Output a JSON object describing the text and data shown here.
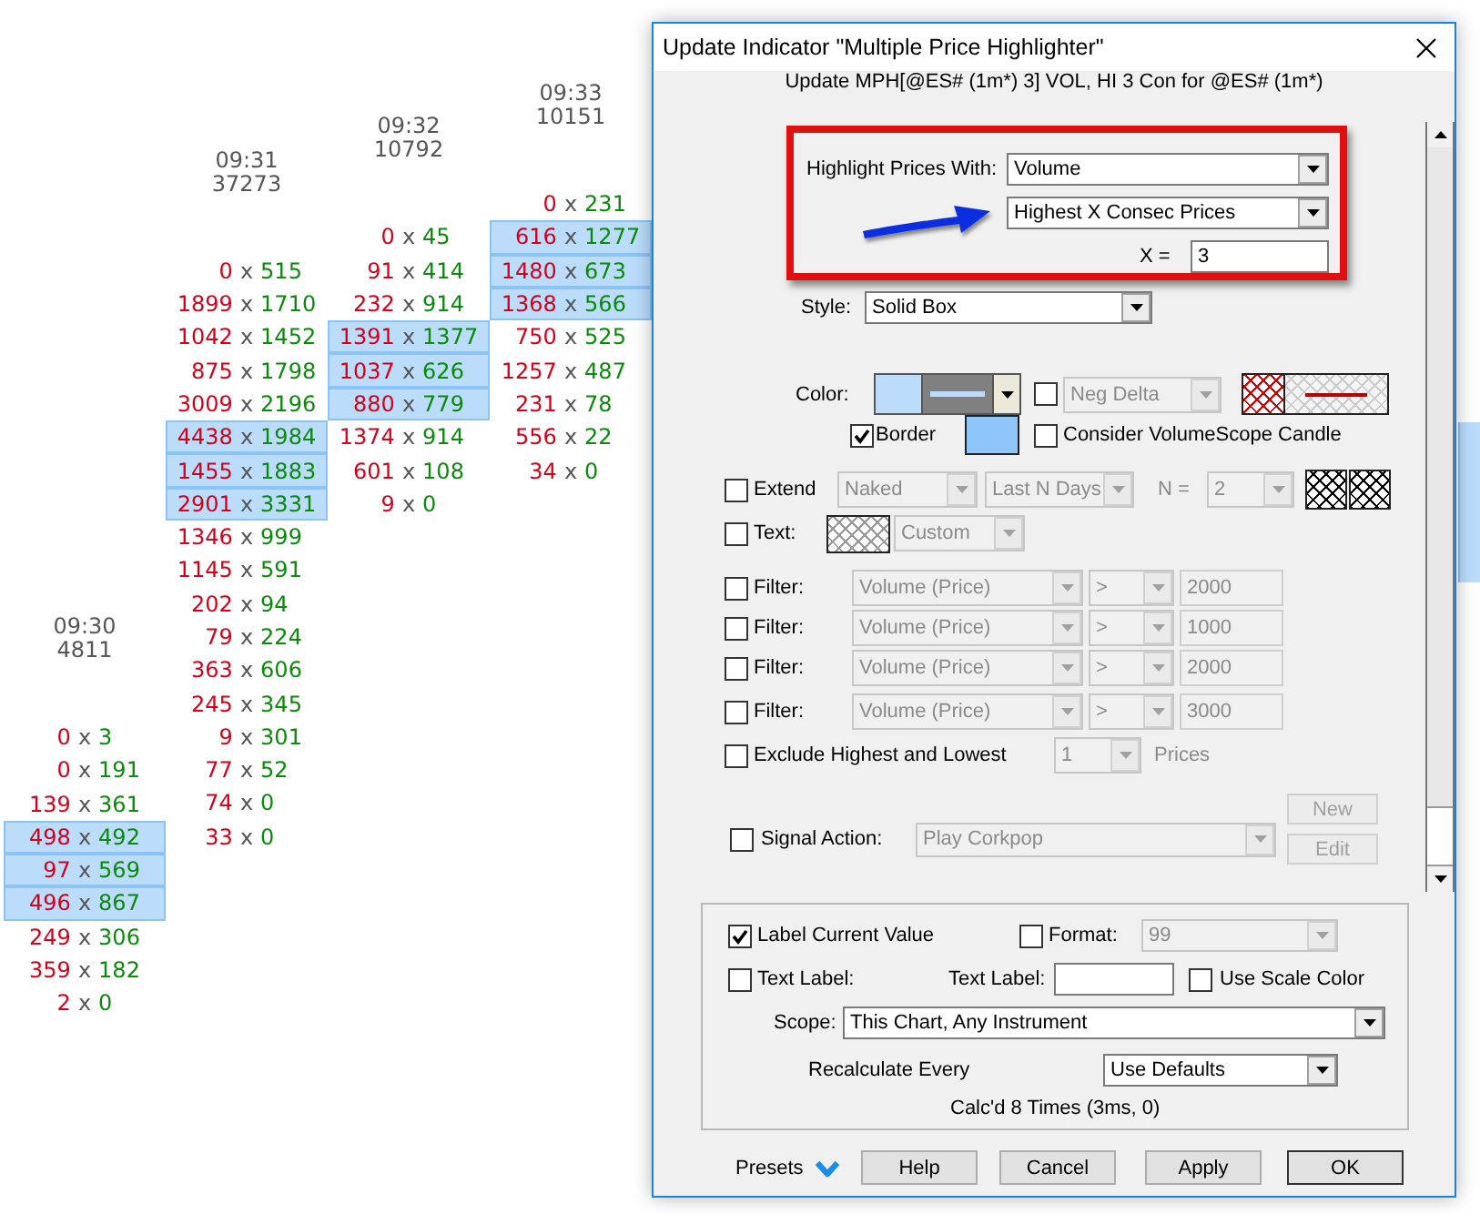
{
  "chart": {
    "columns": [
      {
        "time": "09:30",
        "volume": "4811",
        "cells": [
          {
            "text": "0 x 3",
            "highlighted": false
          },
          {
            "text": "0 x 191",
            "highlighted": false
          },
          {
            "text": "139 x 361",
            "highlighted": false
          },
          {
            "text": "498 x 492",
            "highlighted": true
          },
          {
            "text": "97 x 569",
            "highlighted": true
          },
          {
            "text": "496 x 867",
            "highlighted": true
          },
          {
            "text": "249 x 306",
            "highlighted": false
          },
          {
            "text": "359 x 182",
            "highlighted": false
          },
          {
            "text": "2 x 0",
            "highlighted": false
          }
        ]
      },
      {
        "time": "09:31",
        "volume": "37273",
        "cells": [
          {
            "text": "0 x 515",
            "highlighted": false
          },
          {
            "text": "1899 x 1710",
            "highlighted": false
          },
          {
            "text": "1042 x 1452",
            "highlighted": false
          },
          {
            "text": "875 x 1798",
            "highlighted": false
          },
          {
            "text": "3009 x 2196",
            "highlighted": false
          },
          {
            "text": "4438 x 1984",
            "highlighted": true
          },
          {
            "text": "1455 x 1883",
            "highlighted": true
          },
          {
            "text": "2901 x 3331",
            "highlighted": true
          },
          {
            "text": "1346 x 999",
            "highlighted": false
          },
          {
            "text": "1145 x 591",
            "highlighted": false
          },
          {
            "text": "202 x 94",
            "highlighted": false
          },
          {
            "text": "79 x 224",
            "highlighted": false
          },
          {
            "text": "363 x 606",
            "highlighted": false
          },
          {
            "text": "245 x 345",
            "highlighted": false
          },
          {
            "text": "9 x 301",
            "highlighted": false
          },
          {
            "text": "77 x 52",
            "highlighted": false
          },
          {
            "text": "74 x 0",
            "highlighted": false
          },
          {
            "text": "33 x 0",
            "highlighted": false
          }
        ]
      },
      {
        "time": "09:32",
        "volume": "10792",
        "cells": [
          {
            "text": "0 x 45",
            "highlighted": false
          },
          {
            "text": "91 x 414",
            "highlighted": false
          },
          {
            "text": "232 x 914",
            "highlighted": false
          },
          {
            "text": "1391 x 1377",
            "highlighted": true
          },
          {
            "text": "1037 x 626",
            "highlighted": true
          },
          {
            "text": "880 x 779",
            "highlighted": true
          },
          {
            "text": "1374 x 914",
            "highlighted": false
          },
          {
            "text": "601 x 108",
            "highlighted": false
          },
          {
            "text": "9 x 0",
            "highlighted": false
          }
        ]
      },
      {
        "time": "09:33",
        "volume": "10151",
        "cells": [
          {
            "text": "0 x 231",
            "highlighted": false
          },
          {
            "text": "616 x 1277",
            "highlighted": true
          },
          {
            "text": "1480 x 673",
            "highlighted": true
          },
          {
            "text": "1368 x 566",
            "highlighted": true
          },
          {
            "text": "750 x 525",
            "highlighted": false
          },
          {
            "text": "1257 x 487",
            "highlighted": false
          },
          {
            "text": "231 x 78",
            "highlighted": false
          },
          {
            "text": "556 x 22",
            "highlighted": false
          },
          {
            "text": "34 x 0",
            "highlighted": false
          }
        ]
      }
    ]
  },
  "dialog": {
    "title": "Update Indicator \"Multiple Price Highlighter\"",
    "subtitle": "Update MPH[@ES# (1m*) 3] VOL, HI 3 Con for @ES# (1m*)",
    "highlight": {
      "label": "Highlight Prices With:",
      "source": {
        "value": "Volume",
        "disabled": false
      },
      "method": {
        "value": "Highest X Consec Prices",
        "disabled": false
      },
      "x_label": "X =",
      "x_input": {
        "value": "3",
        "disabled": false
      }
    },
    "style": {
      "label": "Style:",
      "select": {
        "value": "Solid Box",
        "disabled": false
      }
    },
    "color": {
      "label": "Color:",
      "neg_delta": {
        "checked": false,
        "select": {
          "value": "Neg Delta",
          "disabled": true
        }
      }
    },
    "border": {
      "label": "Border",
      "checked": true
    },
    "consider": {
      "label": "Consider VolumeScope Candle",
      "checked": false
    },
    "extend": {
      "label": "Extend",
      "checked": false,
      "type": {
        "value": "Naked",
        "disabled": true
      },
      "range": {
        "value": "Last N Days",
        "disabled": true
      },
      "n_label": "N =",
      "n": {
        "value": "2",
        "disabled": true
      }
    },
    "text": {
      "label": "Text:",
      "checked": false,
      "select": {
        "value": "Custom",
        "disabled": true
      }
    },
    "filters": [
      {
        "label": "Filter:",
        "checked": false,
        "field": {
          "value": "Volume (Price)",
          "disabled": true
        },
        "operator": {
          "value": ">",
          "disabled": true
        },
        "threshold": {
          "value": "2000",
          "disabled": true
        }
      },
      {
        "label": "Filter:",
        "checked": false,
        "field": {
          "value": "Volume (Price)",
          "disabled": true
        },
        "operator": {
          "value": ">",
          "disabled": true
        },
        "threshold": {
          "value": "1000",
          "disabled": true
        }
      },
      {
        "label": "Filter:",
        "checked": false,
        "field": {
          "value": "Volume (Price)",
          "disabled": true
        },
        "operator": {
          "value": ">",
          "disabled": true
        },
        "threshold": {
          "value": "2000",
          "disabled": true
        }
      },
      {
        "label": "Filter:",
        "checked": false,
        "field": {
          "value": "Volume (Price)",
          "disabled": true
        },
        "operator": {
          "value": ">",
          "disabled": true
        },
        "threshold": {
          "value": "3000",
          "disabled": true
        }
      }
    ],
    "exclude": {
      "label": "Exclude Highest and Lowest",
      "checked": false,
      "count": {
        "value": "1",
        "disabled": true
      },
      "unit": "Prices"
    },
    "signal": {
      "label": "Signal Action:",
      "checked": false,
      "select": {
        "value": "Play Corkpop",
        "disabled": true
      }
    },
    "side_buttons": [
      {
        "label": "New",
        "disabled": true
      },
      {
        "label": "Edit",
        "disabled": true
      }
    ],
    "label_group": {
      "label_current": {
        "label": "Label Current Value",
        "checked": true
      },
      "format": {
        "label": "Format:",
        "checked": false,
        "select": {
          "value": "99",
          "disabled": true
        }
      },
      "text_label": {
        "label": "Text Label:",
        "checked": false
      },
      "text_label_field": {
        "label": "Text Label:"
      },
      "scale_color": {
        "label": "Use Scale Color",
        "checked": false
      },
      "scope": {
        "label": "Scope:",
        "select": {
          "value": "This Chart, Any Instrument",
          "disabled": false
        }
      },
      "recalc": {
        "label": "Recalculate Every",
        "select": {
          "value": "Use Defaults",
          "disabled": false
        }
      },
      "calc_status": "Calc'd 8 Times (3ms, 0)"
    },
    "footer": {
      "presets": "Presets",
      "buttons": [
        {
          "label": "Help",
          "default": false
        },
        {
          "label": "Cancel",
          "default": false
        },
        {
          "label": "Apply",
          "default": false
        },
        {
          "label": "OK",
          "default": true
        }
      ]
    }
  }
}
